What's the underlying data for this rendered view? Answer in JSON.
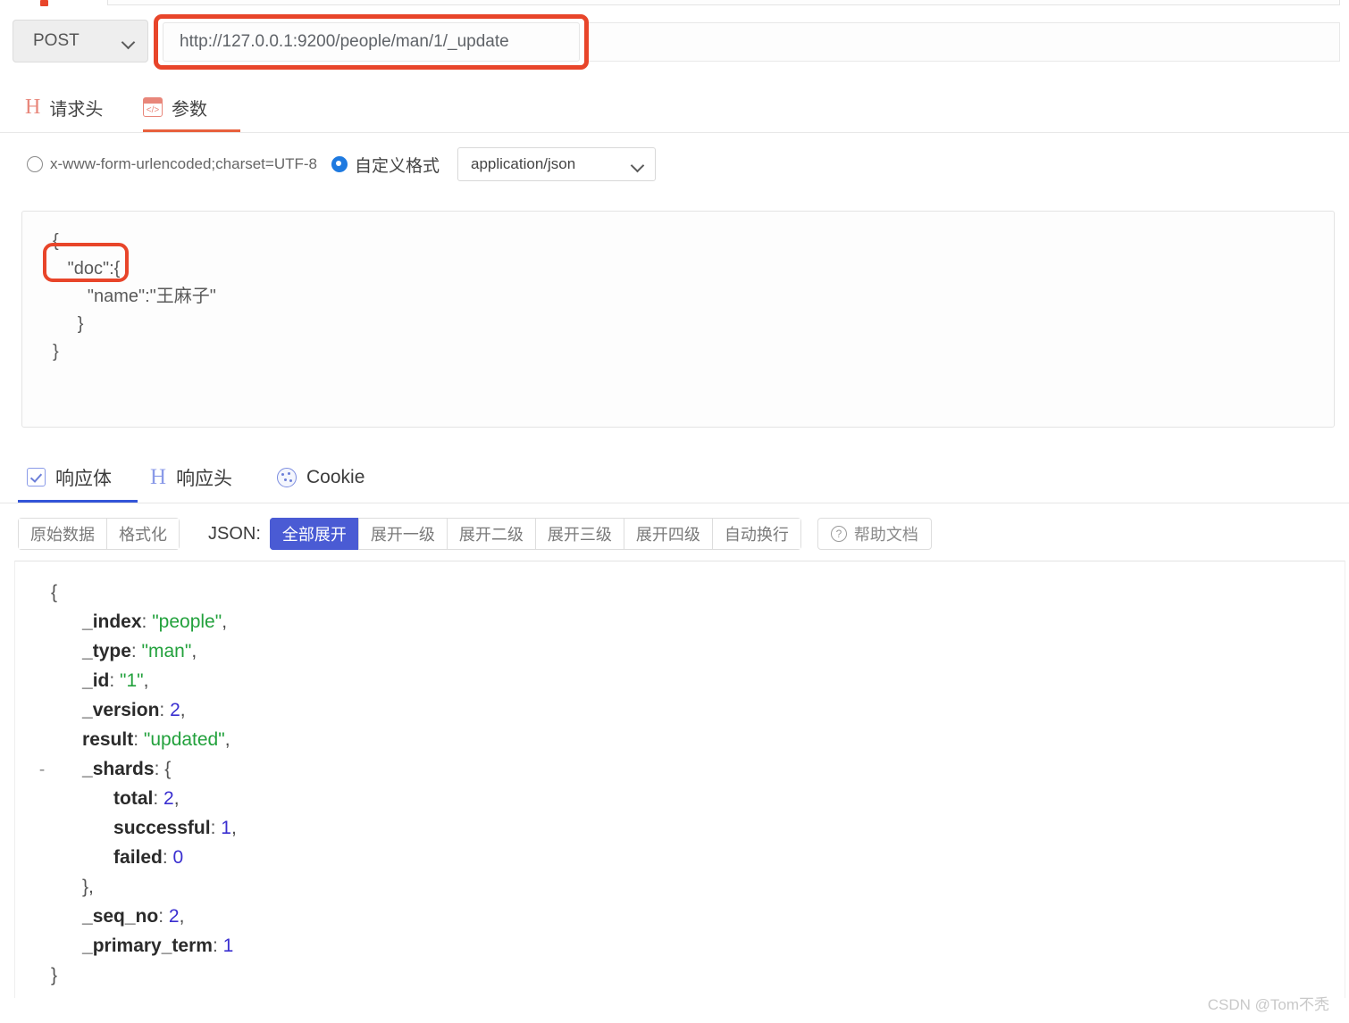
{
  "request": {
    "method": "POST",
    "url": "http://127.0.0.1:9200/people/man/1/_update",
    "tabs": [
      {
        "label": "请求头",
        "icon": "h-icon",
        "active": false
      },
      {
        "label": "参数",
        "icon": "code-icon",
        "active": true
      }
    ],
    "content_type": {
      "option_form": "x-www-form-urlencoded;charset=UTF-8",
      "option_custom": "自定义格式",
      "selected": "custom",
      "format_value": "application/json"
    },
    "body_lines": [
      "{",
      "   \"doc\":{",
      "       \"name\":\"王麻子\"",
      "     }",
      "}"
    ]
  },
  "response": {
    "tabs": [
      {
        "label": "响应体",
        "icon": "checkbox-icon",
        "active": true
      },
      {
        "label": "响应头",
        "icon": "h-icon",
        "active": false
      },
      {
        "label": "Cookie",
        "icon": "cookie-icon",
        "active": false
      }
    ],
    "toolbar": {
      "raw_label": "原始数据",
      "format_label": "格式化",
      "json_label": "JSON:",
      "expand_buttons": [
        {
          "label": "全部展开",
          "active": true
        },
        {
          "label": "展开一级",
          "active": false
        },
        {
          "label": "展开二级",
          "active": false
        },
        {
          "label": "展开三级",
          "active": false
        },
        {
          "label": "展开四级",
          "active": false
        },
        {
          "label": "自动换行",
          "active": false
        }
      ],
      "help_label": "帮助文档"
    },
    "json": {
      "open_brace": "{",
      "close_brace": "}",
      "collapse_marker": "-",
      "rows": [
        {
          "key": "_index",
          "colon": ":",
          "value": "\"people\"",
          "type": "string",
          "comma": ",",
          "indent": 2,
          "toggle": false
        },
        {
          "key": "_type",
          "colon": ":",
          "value": "\"man\"",
          "type": "string",
          "comma": ",",
          "indent": 2,
          "toggle": false
        },
        {
          "key": "_id",
          "colon": ":",
          "value": "\"1\"",
          "type": "string",
          "comma": ",",
          "indent": 2,
          "toggle": false
        },
        {
          "key": "_version",
          "colon": ":",
          "value": "2",
          "type": "number",
          "comma": ",",
          "indent": 2,
          "toggle": false
        },
        {
          "key": "result",
          "colon": ":",
          "value": "\"updated\"",
          "type": "string",
          "comma": ",",
          "indent": 2,
          "toggle": false
        },
        {
          "key": "_shards",
          "colon": ":",
          "value": "{",
          "type": "brace",
          "comma": "",
          "indent": 2,
          "toggle": true
        },
        {
          "key": "total",
          "colon": ":",
          "value": "2",
          "type": "number",
          "comma": ",",
          "indent": 4,
          "toggle": false
        },
        {
          "key": "successful",
          "colon": ":",
          "value": "1",
          "type": "number",
          "comma": ",",
          "indent": 4,
          "toggle": false
        },
        {
          "key": "failed",
          "colon": ":",
          "value": "0",
          "type": "number",
          "comma": "",
          "indent": 4,
          "toggle": false
        },
        {
          "key": "",
          "colon": "",
          "value": "}",
          "type": "brace",
          "comma": ",",
          "indent": 2,
          "toggle": false
        },
        {
          "key": "_seq_no",
          "colon": ":",
          "value": "2",
          "type": "number",
          "comma": ",",
          "indent": 2,
          "toggle": false
        },
        {
          "key": "_primary_term",
          "colon": ":",
          "value": "1",
          "type": "number",
          "comma": "",
          "indent": 2,
          "toggle": false
        }
      ]
    }
  },
  "watermark": "CSDN @Tom不秃",
  "colors": {
    "highlight_red": "#e8452a",
    "tab_active_red": "#e8603d",
    "tab_active_blue": "#3355d8",
    "button_active_blue": "#4a5bd4",
    "json_string_green": "#22a13c",
    "json_number_blue": "#3a2fd0",
    "radio_blue": "#1f7ae0"
  }
}
